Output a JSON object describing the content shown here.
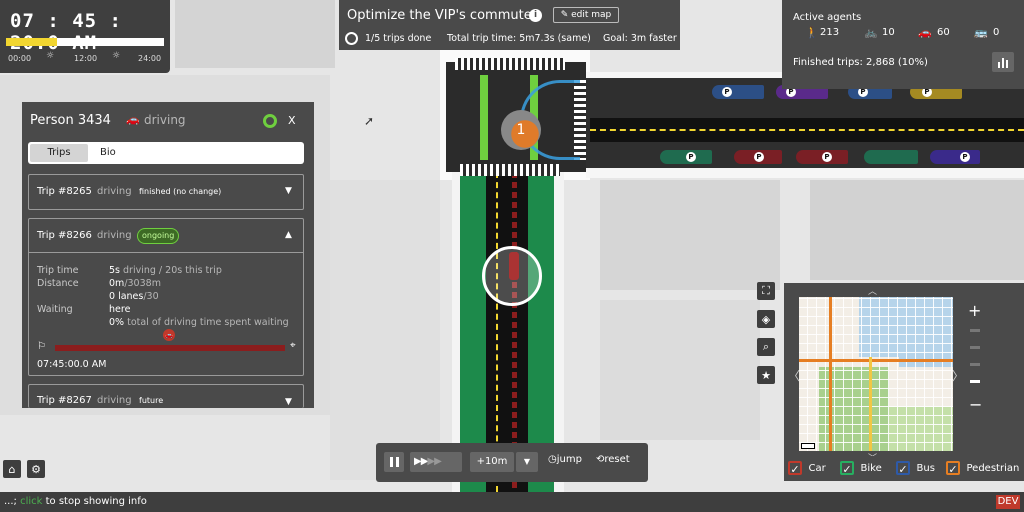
{
  "clock": {
    "time": "07 : 45 : 20.0 AM",
    "progress": 0.32,
    "labels": [
      "00:00",
      "12:00",
      "24:00"
    ]
  },
  "challenge": {
    "title": "Optimize the VIP's commute",
    "edit_map": "edit map",
    "trips_done": "1/5 trips done",
    "total_time": "Total trip time: 5m7.3s (same)",
    "goal": "Goal: 3m faster"
  },
  "agents": {
    "title": "Active agents",
    "walking": "213",
    "biking": "10",
    "driving": "60",
    "transit": "0",
    "finished": "Finished trips: 2,868 (10%)"
  },
  "person": {
    "name": "Person 3434",
    "mode": "driving",
    "close": "X",
    "tabs": [
      "Trips",
      "Bio"
    ],
    "trips": [
      {
        "id": "Trip #8265",
        "mode": "driving",
        "status": "finished (no change)"
      },
      {
        "id": "Trip #8266",
        "mode": "driving",
        "status": "ongoing"
      },
      {
        "id": "Trip #8267",
        "mode": "driving",
        "status": "future"
      }
    ],
    "details": {
      "trip_time_label": "Trip time",
      "trip_time_a": "5s",
      "trip_time_b": " driving / 20s this trip",
      "distance_label": "Distance",
      "distance_a": "0m",
      "distance_b": "/3038m",
      "lanes_a": "0 lanes",
      "lanes_b": "/30",
      "waiting_label": "Waiting",
      "waiting_a": "here",
      "waiting_pct": "0%",
      "waiting_b": " total of driving time spent waiting",
      "start_time": "07:45:00.0 AM",
      "progress": 0.0
    }
  },
  "map": {
    "intersection_label": "1"
  },
  "controls": {
    "jump_amount": "+10m",
    "jump": "jump",
    "reset": "reset"
  },
  "legend": [
    "Car",
    "Bike",
    "Bus",
    "Pedestrian"
  ],
  "legend_colors": [
    "#c0392b",
    "#27ae60",
    "#2e5aa8",
    "#e67e22"
  ],
  "status": {
    "prefix": "...; ",
    "click": "click",
    "rest": " to stop showing info",
    "dev": "DEV"
  }
}
